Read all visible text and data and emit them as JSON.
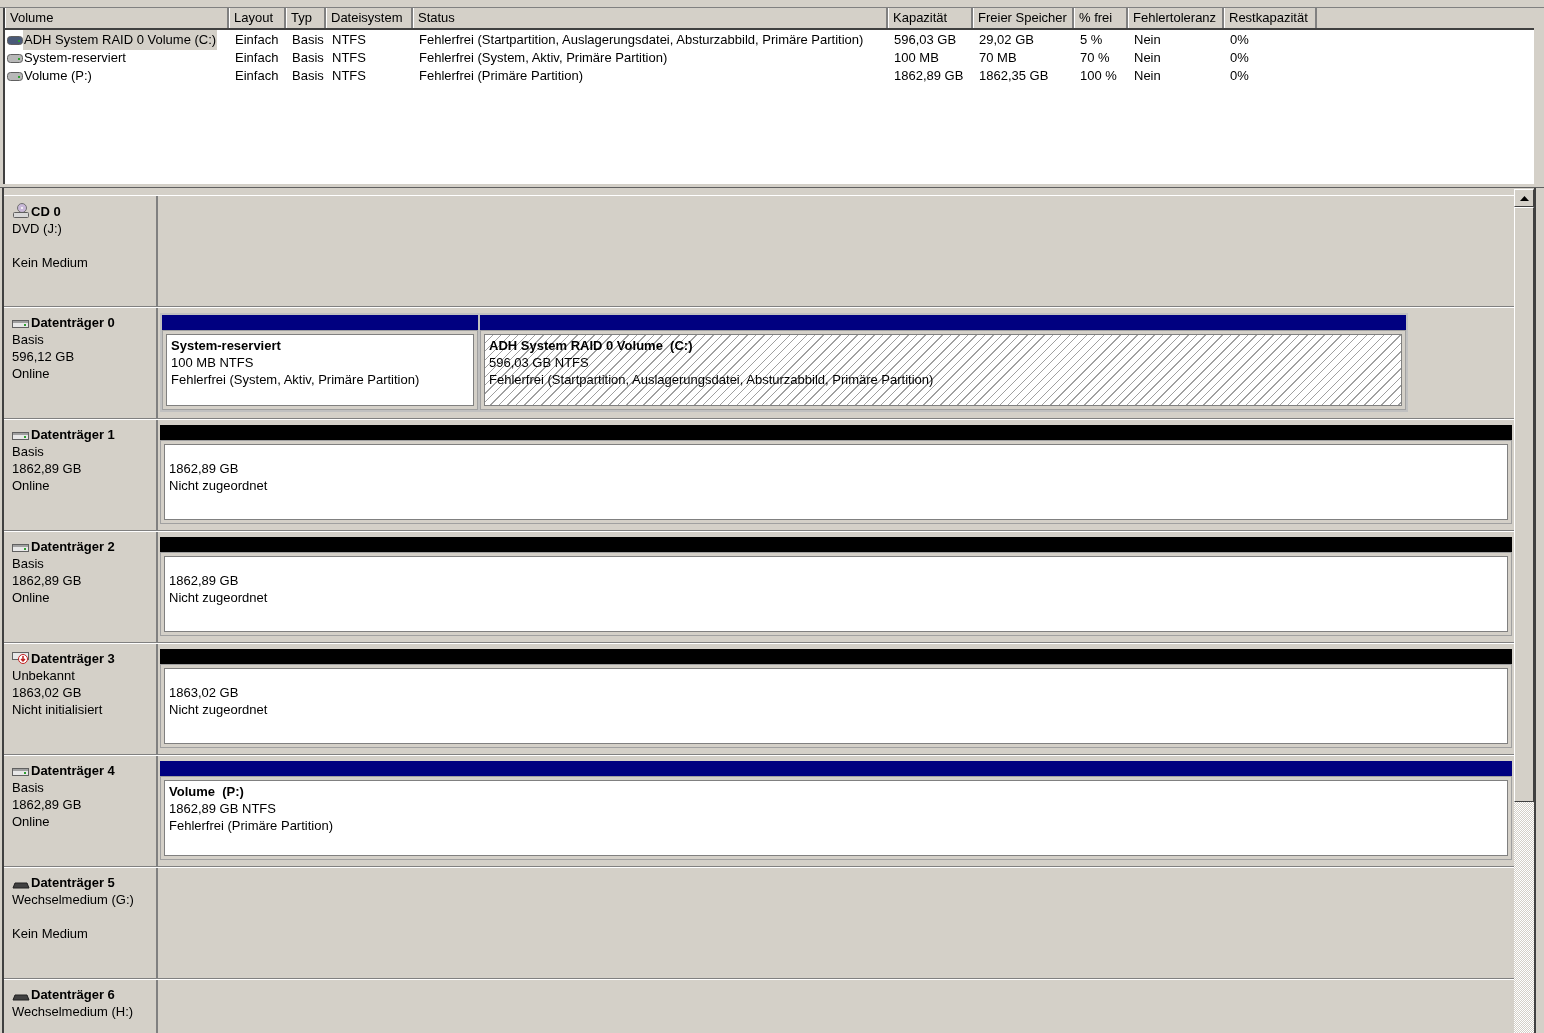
{
  "volume_table": {
    "columns": [
      "Volume",
      "Layout",
      "Typ",
      "Dateisystem",
      "Status",
      "Kapazität",
      "Freier Speicher",
      "% frei",
      "Fehlertoleranz",
      "Restkapazität"
    ],
    "rows": [
      {
        "selected": true,
        "cells": [
          "ADH System RAID 0 Volume (C:)",
          "Einfach",
          "Basis",
          "NTFS",
          "Fehlerfrei (Startpartition, Auslagerungsdatei, Absturzabbild, Primäre Partition)",
          "596,03 GB",
          "29,02 GB",
          "5 %",
          "Nein",
          "0%"
        ]
      },
      {
        "selected": false,
        "cells": [
          "System-reserviert",
          "Einfach",
          "Basis",
          "NTFS",
          "Fehlerfrei (System, Aktiv, Primäre Partition)",
          "100 MB",
          "70 MB",
          "70 %",
          "Nein",
          "0%"
        ]
      },
      {
        "selected": false,
        "cells": [
          "Volume (P:)",
          "Einfach",
          "Basis",
          "NTFS",
          "Fehlerfrei (Primäre Partition)",
          "1862,89 GB",
          "1862,35 GB",
          "100 %",
          "Nein",
          "0%"
        ]
      }
    ]
  },
  "disks": [
    {
      "kind": "cd",
      "name": "CD 0",
      "lines": [
        "DVD (J:)"
      ],
      "media": "Kein Medium"
    },
    {
      "kind": "disk",
      "name": "Datenträger 0",
      "lines": [
        "Basis",
        "596,12 GB",
        "Online"
      ],
      "partitions": [
        {
          "kind": "primary",
          "selected": false,
          "title": "System-reserviert",
          "lines": [
            "100 MB NTFS",
            "Fehlerfrei (System, Aktiv, Primäre Partition)"
          ]
        },
        {
          "kind": "primary",
          "selected": true,
          "title": "ADH System RAID 0 Volume  (C:)",
          "lines": [
            "596,03 GB NTFS",
            "Fehlerfrei (Startpartition, Auslagerungsdatei, Absturzabbild, Primäre Partition)"
          ]
        }
      ]
    },
    {
      "kind": "disk",
      "name": "Datenträger 1",
      "lines": [
        "Basis",
        "1862,89 GB",
        "Online"
      ],
      "partitions": [
        {
          "kind": "unallocated",
          "selected": false,
          "lines": [
            "1862,89 GB",
            "Nicht zugeordnet"
          ]
        }
      ]
    },
    {
      "kind": "disk",
      "name": "Datenträger 2",
      "lines": [
        "Basis",
        "1862,89 GB",
        "Online"
      ],
      "partitions": [
        {
          "kind": "unallocated",
          "selected": false,
          "lines": [
            "1862,89 GB",
            "Nicht zugeordnet"
          ]
        }
      ]
    },
    {
      "kind": "unknown",
      "name": "Datenträger 3",
      "lines": [
        "Unbekannt",
        "1863,02 GB",
        "Nicht initialisiert"
      ],
      "partitions": [
        {
          "kind": "unallocated",
          "selected": false,
          "lines": [
            "1863,02 GB",
            "Nicht zugeordnet"
          ]
        }
      ]
    },
    {
      "kind": "disk",
      "name": "Datenträger 4",
      "lines": [
        "Basis",
        "1862,89 GB",
        "Online"
      ],
      "partitions": [
        {
          "kind": "primary",
          "selected": false,
          "title": "Volume  (P:)",
          "lines": [
            "1862,89 GB NTFS",
            "Fehlerfrei (Primäre Partition)"
          ]
        }
      ]
    },
    {
      "kind": "removable",
      "name": "Datenträger 5",
      "lines": [
        "Wechselmedium (G:)"
      ],
      "media": "Kein Medium"
    },
    {
      "kind": "removable",
      "name": "Datenträger 6",
      "lines": [
        "Wechselmedium (H:)"
      ]
    }
  ]
}
